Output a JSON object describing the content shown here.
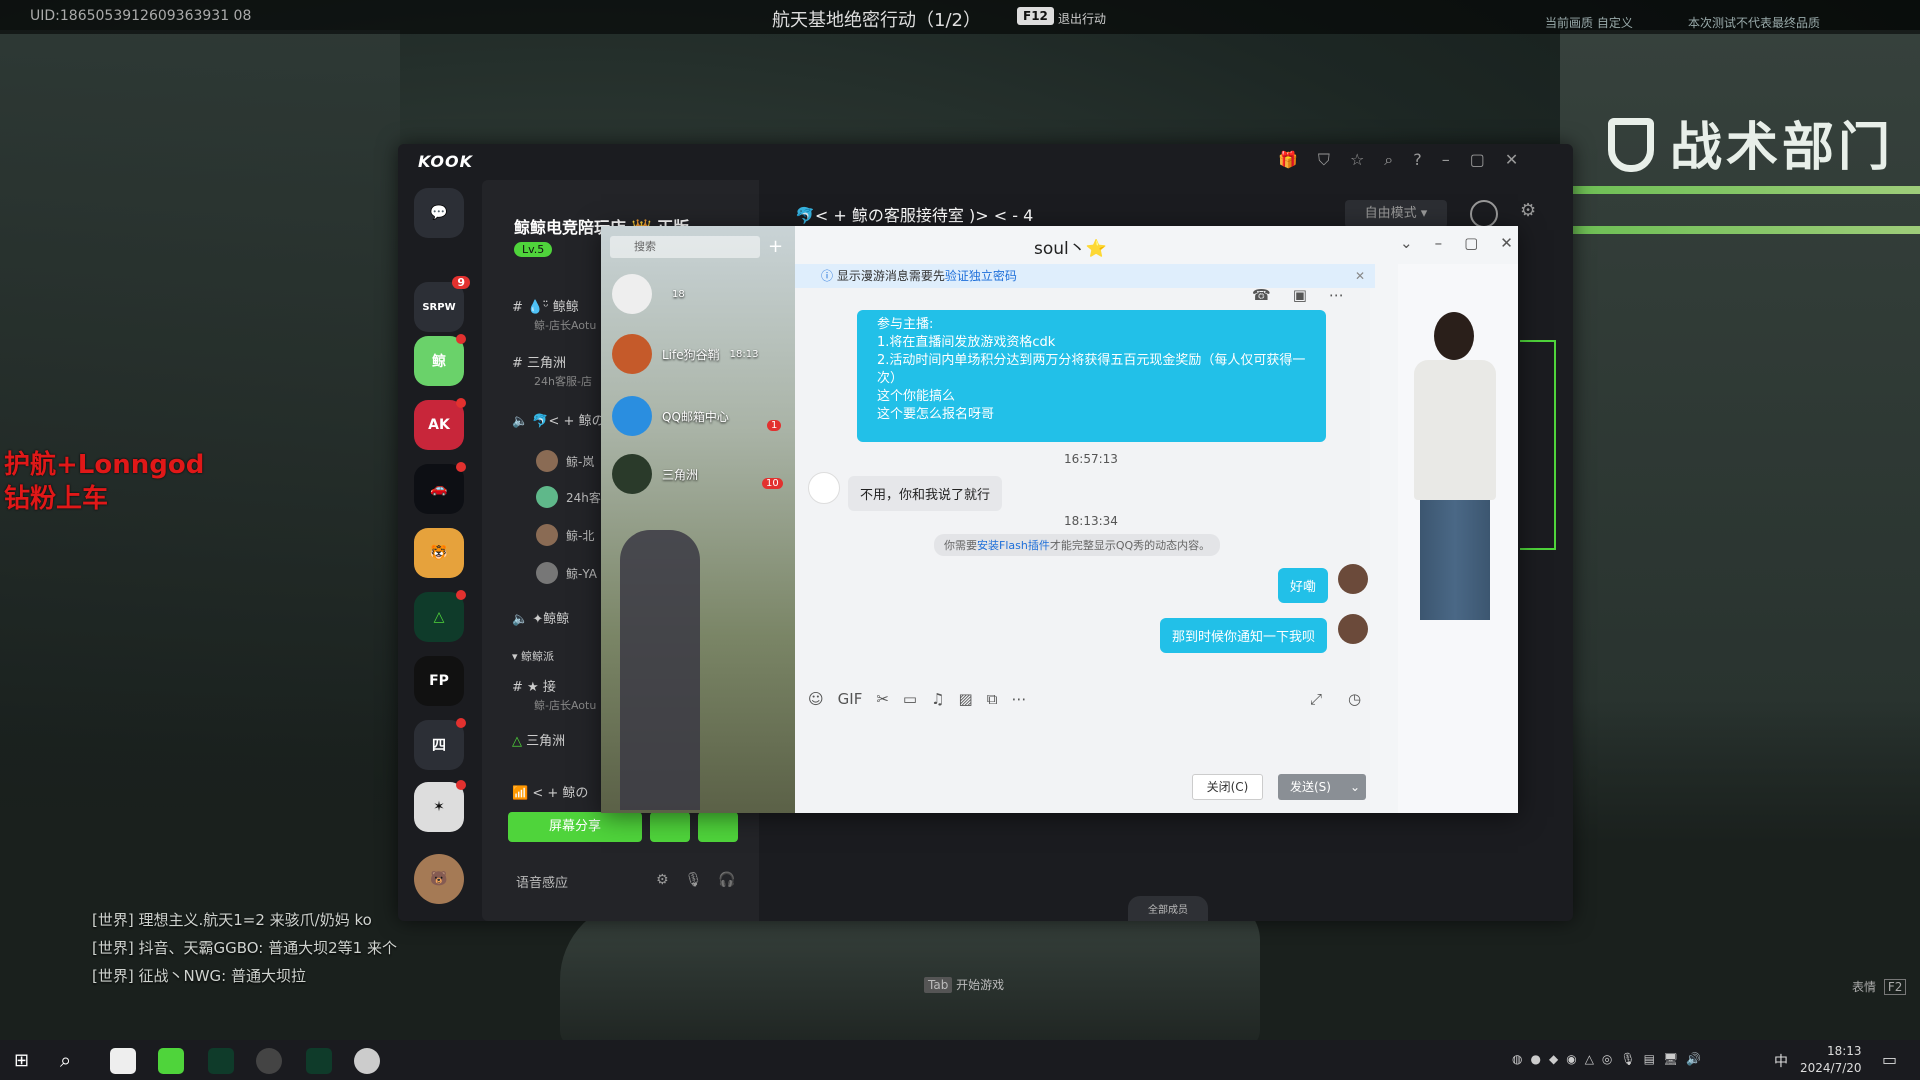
{
  "game": {
    "uid": "UID:1865053912609363931 08",
    "mission": "航天基地绝密行动（1/2）",
    "hotkey": "F12",
    "exit_label": "退出行动",
    "top_right_1": "当前画质  自定义",
    "top_right_2": "本次测试不代表最终品质",
    "sign": "战术部门",
    "promo": [
      "护航+Lonngod",
      "钻粉上车"
    ],
    "chat": [
      "[世界] 理想主义.航天1=2 来骇爪/奶妈 ko",
      "[世界] 抖音、天霸GGBO: 普通大坝2等1 来个",
      "[世界] 征战丶NWG: 普通大坝拉"
    ],
    "tab_hint": "Tab",
    "start_game": "开始游戏",
    "emote_label": "表情",
    "emote_key": "F2"
  },
  "kook": {
    "logo": "KOOK",
    "server": {
      "name": "鲸鲸电竞陪玩店 👑 正版",
      "level": "Lv.5"
    },
    "channels": [
      {
        "name": "💧ᵕ̈ 鲸鲸",
        "sub": "鲸-店长Aotu"
      },
      {
        "name": "三角洲",
        "sub": "24h客服-店"
      },
      {
        "name": "🐬< + 鲸の",
        "sub": ""
      }
    ],
    "users": [
      "鲸-岚",
      "24h客",
      "鲸-北",
      "鲸-YA"
    ],
    "channels2": [
      {
        "name": "✦鲸鲸",
        "sub": ""
      },
      {
        "name": "鲸鲸派",
        "sub": ""
      },
      {
        "name": "★ 接",
        "sub": "鲸-店长Aotu"
      },
      {
        "name": "三角洲",
        "sub": ""
      },
      {
        "name": "< + 鲸の",
        "sub": ""
      }
    ],
    "share_button": "屏幕分享",
    "voice_label": "语音感应",
    "main_title": "🐬< + 鲸の客服接待室 )> < - 4",
    "free_mode": "自由模式 ▾",
    "members_label": "全部成员",
    "rail": [
      {
        "label": "💬",
        "badge": ""
      },
      {
        "label": "SRPW",
        "badge": "9"
      },
      {
        "label": "鲸",
        "badge": ""
      },
      {
        "label": "AK",
        "badge": ""
      },
      {
        "label": "🚗",
        "badge": ""
      },
      {
        "label": "🐯",
        "badge": ""
      },
      {
        "label": "△",
        "badge": ""
      },
      {
        "label": "FP",
        "badge": ""
      },
      {
        "label": "四",
        "badge": ""
      },
      {
        "label": "✶",
        "badge": ""
      },
      {
        "label": "🐻",
        "badge": ""
      }
    ]
  },
  "qq": {
    "search_placeholder": "搜索",
    "contacts": [
      {
        "name": "",
        "time": "18",
        "badge": ""
      },
      {
        "name": "Life狗谷鞘",
        "time": "18:13",
        "badge": ""
      },
      {
        "name": "QQ邮箱中心",
        "time": "",
        "badge": "1"
      },
      {
        "name": "三角洲",
        "time": "",
        "badge": "10"
      }
    ],
    "title": "soul丶⭐",
    "banner": {
      "text": "显示漫游消息需要先",
      "link": "验证独立密码"
    },
    "message_big": [
      "参与主播:",
      "1.将在直播间发放游戏资格cdk",
      "2.活动时间内单场积分达到两万分将获得五百元现金奖励（每人仅可获得一次）",
      "这个你能搞么",
      "",
      "这个要怎么报名呀哥"
    ],
    "time1": "16:57:13",
    "reply": "不用，你和我说了就行",
    "time2": "18:13:34",
    "sys": {
      "pre": "你需要",
      "link": "安装Flash插件",
      "post": "才能完整显示QQ秀的动态内容。"
    },
    "me1": "好嘞",
    "me2": "那到时候你通知一下我呗",
    "btn_close": "关闭(C)",
    "btn_send": "发送(S)"
  },
  "taskbar": {
    "time": "18:13",
    "date": "2024/7/20",
    "lang": "中"
  }
}
